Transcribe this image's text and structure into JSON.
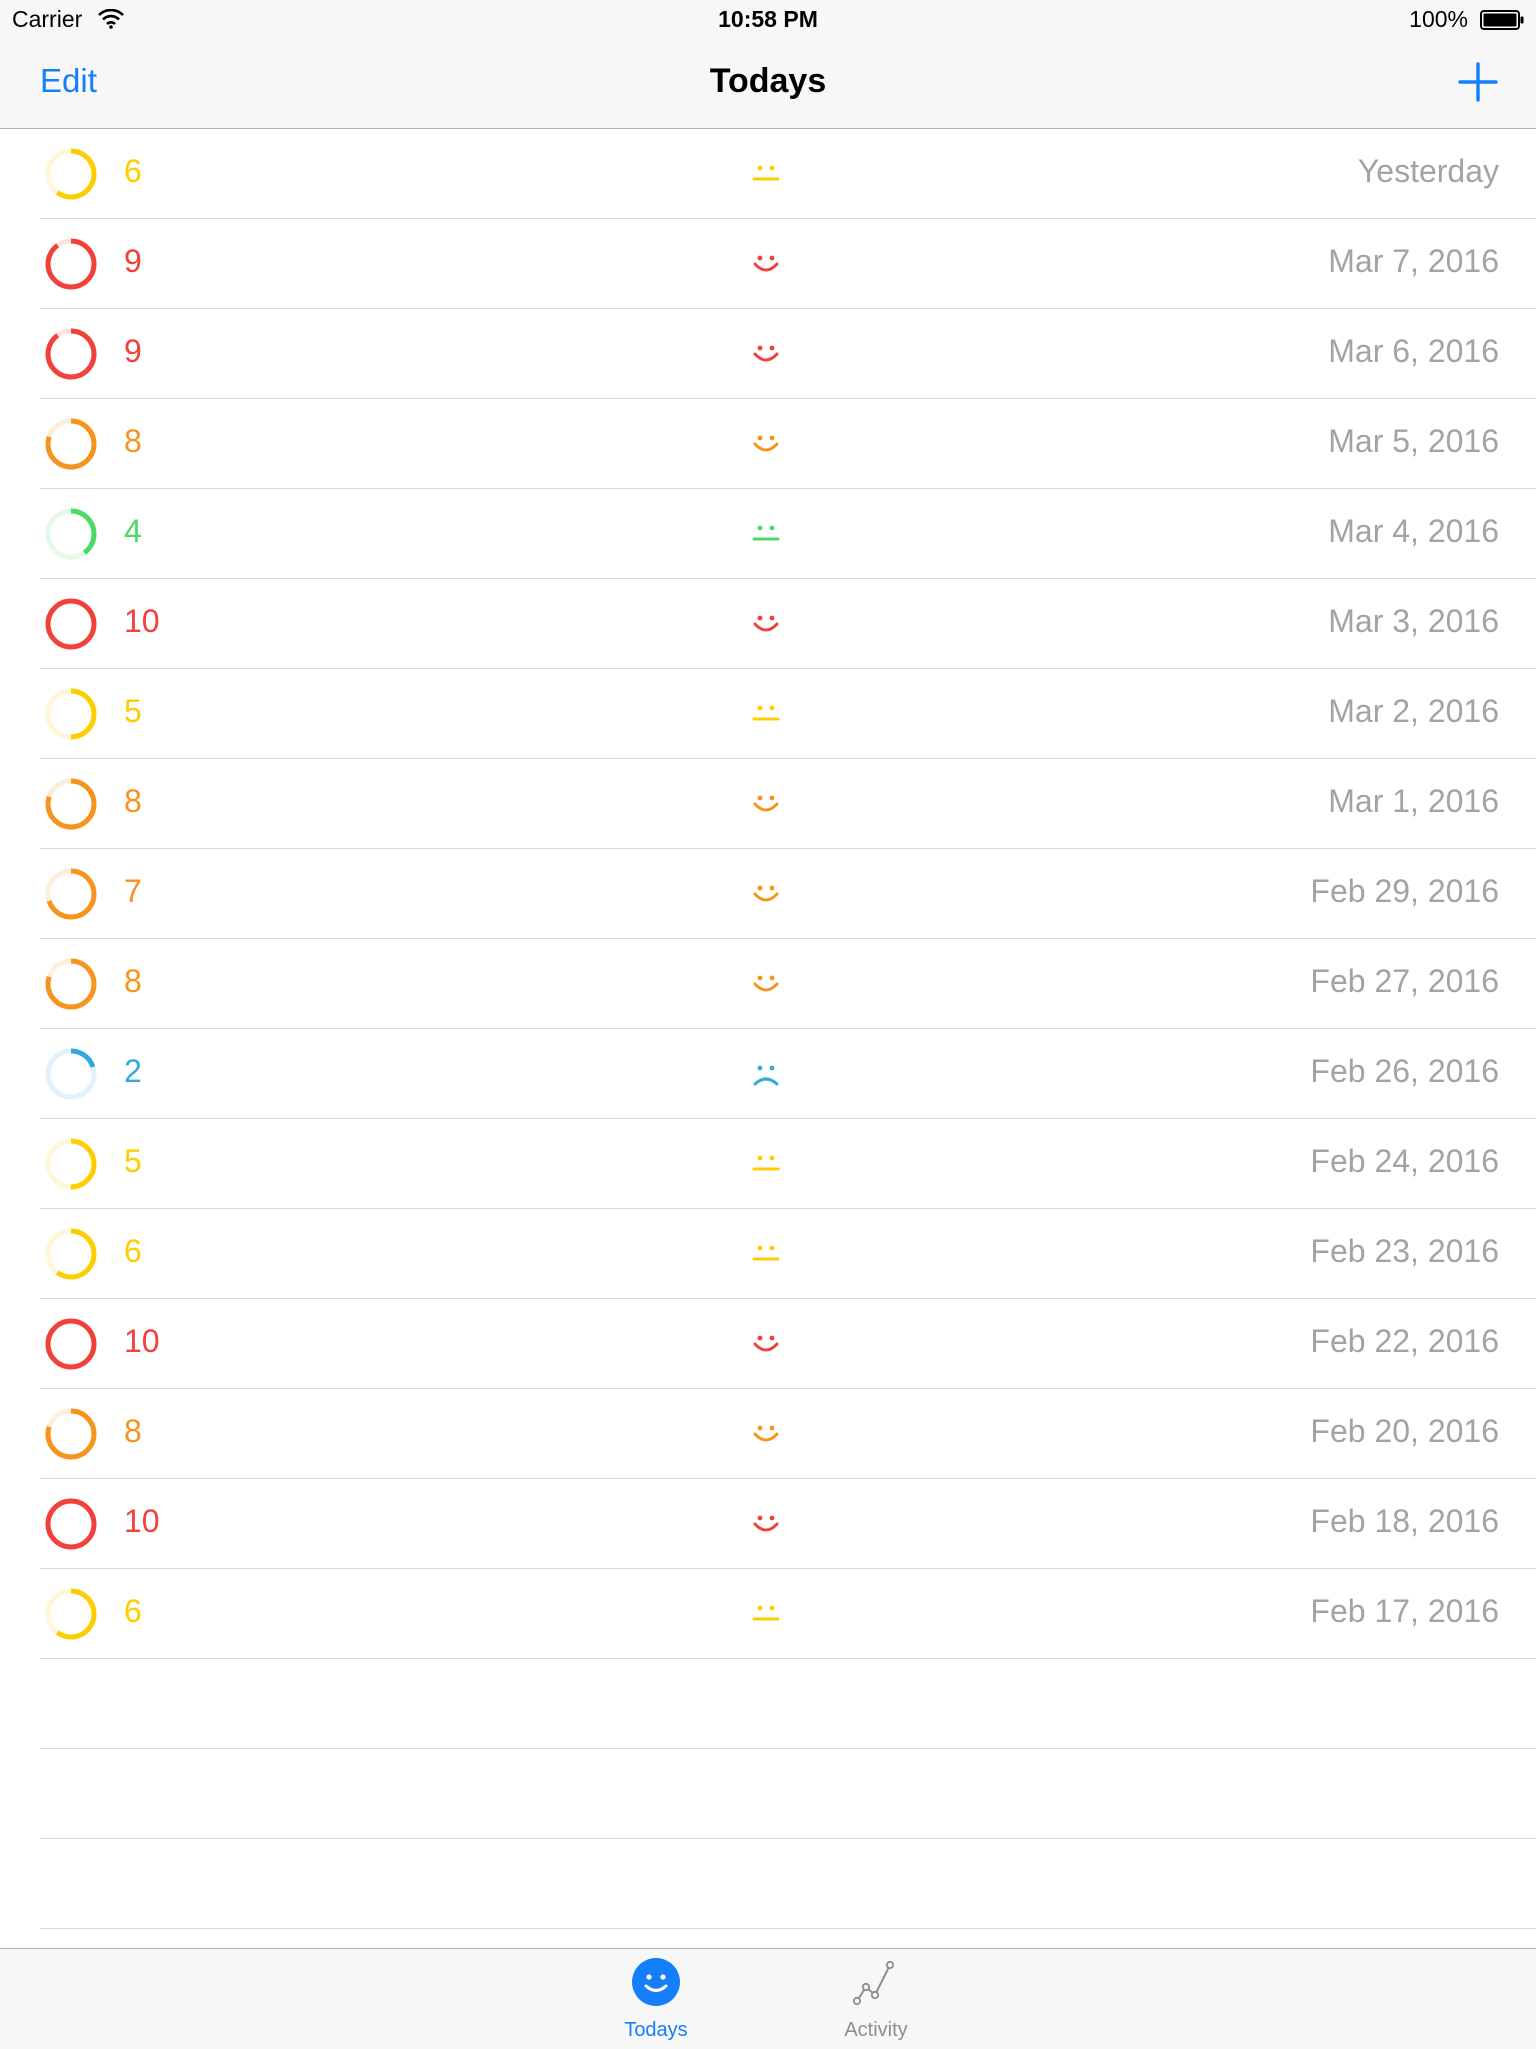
{
  "status_bar": {
    "carrier": "Carrier",
    "time": "10:58 PM",
    "battery": "100%"
  },
  "nav": {
    "edit_label": "Edit",
    "title": "Todays",
    "add_icon": "plus-icon"
  },
  "colors": {
    "red": "#f2403a",
    "orange": "#f7941d",
    "yellow": "#ffcc00",
    "green": "#4cd964",
    "blue": "#34aadc",
    "date_gray": "#a3a3a3",
    "tint": "#147efb"
  },
  "entries": [
    {
      "score": "6",
      "level": 0.6,
      "mood": "neutral",
      "color": "#ffcc00",
      "date": "Yesterday"
    },
    {
      "score": "9",
      "level": 0.9,
      "mood": "happy",
      "color": "#f2403a",
      "date": "Mar 7, 2016"
    },
    {
      "score": "9",
      "level": 0.9,
      "mood": "happy",
      "color": "#f2403a",
      "date": "Mar 6, 2016"
    },
    {
      "score": "8",
      "level": 0.8,
      "mood": "happy",
      "color": "#f7941d",
      "date": "Mar 5, 2016"
    },
    {
      "score": "4",
      "level": 0.4,
      "mood": "neutral",
      "color": "#4cd964",
      "date": "Mar 4, 2016"
    },
    {
      "score": "10",
      "level": 1.0,
      "mood": "happy",
      "color": "#f2403a",
      "date": "Mar 3, 2016"
    },
    {
      "score": "5",
      "level": 0.5,
      "mood": "neutral",
      "color": "#ffcc00",
      "date": "Mar 2, 2016"
    },
    {
      "score": "8",
      "level": 0.8,
      "mood": "happy",
      "color": "#f7941d",
      "date": "Mar 1, 2016"
    },
    {
      "score": "7",
      "level": 0.7,
      "mood": "happy",
      "color": "#f7941d",
      "date": "Feb 29, 2016"
    },
    {
      "score": "8",
      "level": 0.8,
      "mood": "happy",
      "color": "#f7941d",
      "date": "Feb 27, 2016"
    },
    {
      "score": "2",
      "level": 0.2,
      "mood": "sad",
      "color": "#34aadc",
      "date": "Feb 26, 2016"
    },
    {
      "score": "5",
      "level": 0.5,
      "mood": "neutral",
      "color": "#ffcc00",
      "date": "Feb 24, 2016"
    },
    {
      "score": "6",
      "level": 0.6,
      "mood": "neutral",
      "color": "#ffcc00",
      "date": "Feb 23, 2016"
    },
    {
      "score": "10",
      "level": 1.0,
      "mood": "happy",
      "color": "#f2403a",
      "date": "Feb 22, 2016"
    },
    {
      "score": "8",
      "level": 0.8,
      "mood": "happy",
      "color": "#f7941d",
      "date": "Feb 20, 2016"
    },
    {
      "score": "10",
      "level": 1.0,
      "mood": "happy",
      "color": "#f2403a",
      "date": "Feb 18, 2016"
    },
    {
      "score": "6",
      "level": 0.6,
      "mood": "neutral",
      "color": "#ffcc00",
      "date": "Feb 17, 2016"
    }
  ],
  "tabs": [
    {
      "label": "Todays",
      "icon": "smiley-icon",
      "active": true
    },
    {
      "label": "Activity",
      "icon": "activity-chart-icon",
      "active": false
    }
  ]
}
